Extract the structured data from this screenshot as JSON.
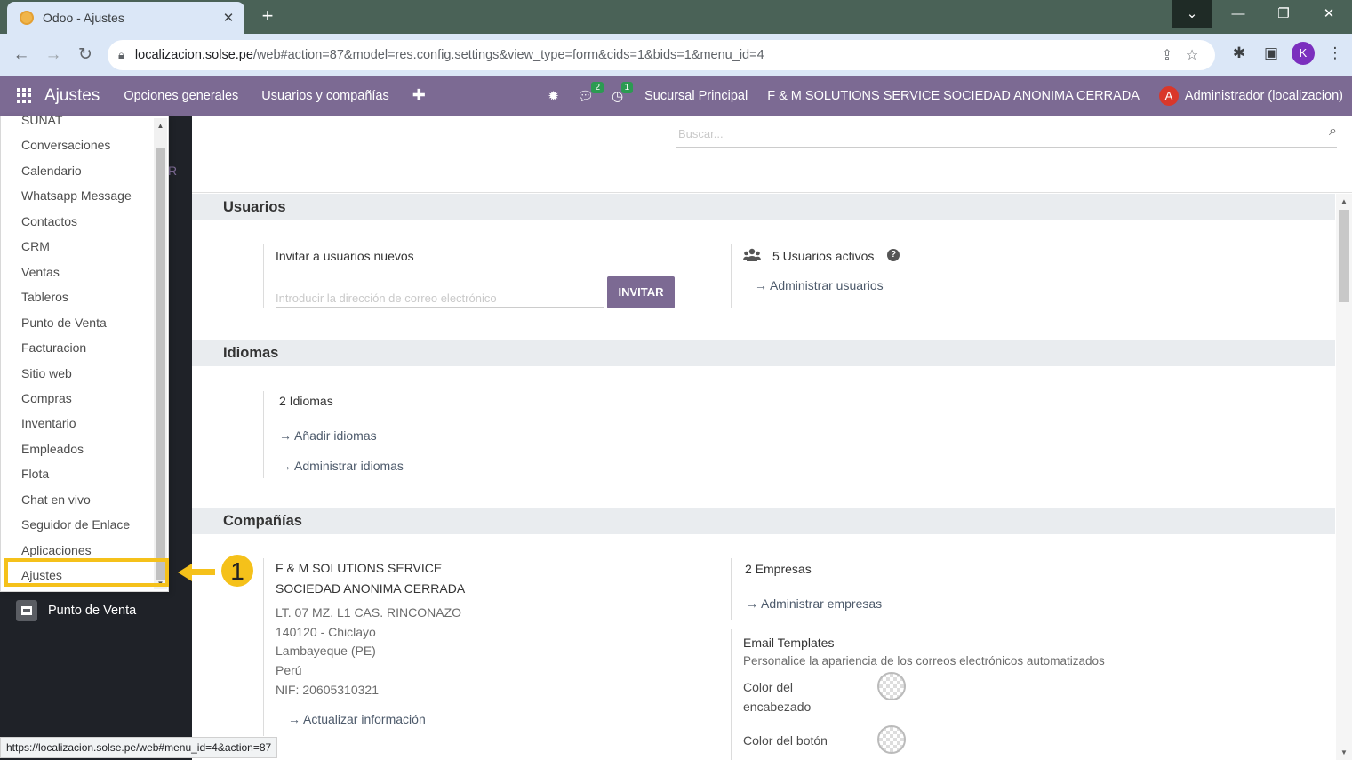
{
  "browser": {
    "tab_title": "Odoo - Ajustes",
    "url_host": "localizacion.solse.pe",
    "url_path": "/web#action=87&model=res.config.settings&view_type=form&cids=1&bids=1&menu_id=4",
    "profile_initial": "K",
    "status_url": "https://localizacion.solse.pe/web#menu_id=4&action=87"
  },
  "odoo_nav": {
    "brand": "Ajustes",
    "menus": [
      "Opciones generales",
      "Usuarios y compañías"
    ],
    "chat_badge": "2",
    "activity_badge": "1",
    "branch": "Sucursal Principal",
    "company": "F & M SOLUTIONS SERVICE SOCIEDAD ANONIMA CERRADA",
    "user_initial": "A",
    "user": "Administrador (localizacion)"
  },
  "dropdown": {
    "items": [
      "SUNAT",
      "Conversaciones",
      "Calendario",
      "Whatsapp Message",
      "Contactos",
      "CRM",
      "Ventas",
      "Tableros",
      "Punto de Venta",
      "Facturacion",
      "Sitio web",
      "Compras",
      "Inventario",
      "Empleados",
      "Flota",
      "Chat en vivo",
      "Seguidor de Enlace",
      "Aplicaciones",
      "Ajustes"
    ]
  },
  "sidebar": {
    "pos_label": "Punto de Venta",
    "stray_letter": "R"
  },
  "annotation": {
    "step": "1"
  },
  "search": {
    "placeholder": "Buscar..."
  },
  "usuarios": {
    "title": "Usuarios",
    "invite_label": "Invitar a usuarios nuevos",
    "email_placeholder": "Introducir la dirección de correo electrónico",
    "invite_button": "INVITAR",
    "active_users": "5 Usuarios activos",
    "manage_users": "Administrar usuarios"
  },
  "idiomas": {
    "title": "Idiomas",
    "count": "2 Idiomas",
    "add": "Añadir idiomas",
    "manage": "Administrar idiomas"
  },
  "companias": {
    "title": "Compañías",
    "name_line1": "F & M SOLUTIONS SERVICE",
    "name_line2": "SOCIEDAD ANONIMA CERRADA",
    "address": "LT. 07 MZ. L1 CAS. RINCONAZO",
    "city": "140120 - Chiclayo",
    "state": "Lambayeque (PE)",
    "country": "Perú",
    "nif": "NIF:  20605310321",
    "update": "Actualizar información",
    "companies_count": "2 Empresas",
    "manage_companies": "Administrar empresas",
    "email_templates_title": "Email Templates",
    "email_templates_desc": "Personalice la apariencia de los correos electrónicos automatizados",
    "header_color_line1": "Color del",
    "header_color_line2": "encabezado",
    "button_color": "Color del botón"
  },
  "colors": {
    "odoo_purple": "#7c6a93",
    "highlight": "#f5c11a"
  }
}
